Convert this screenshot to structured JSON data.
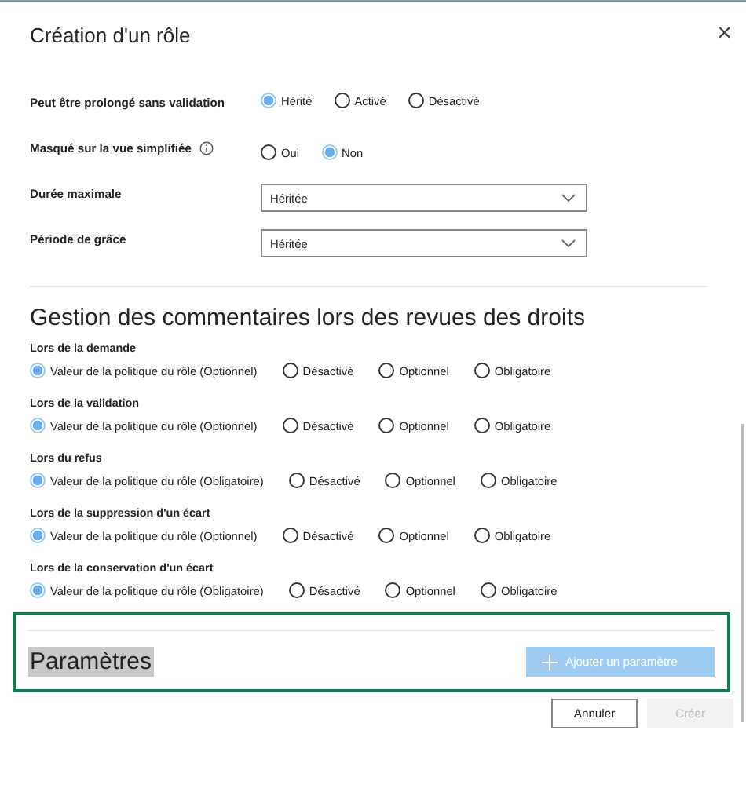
{
  "dialog": {
    "title": "Création d'un rôle",
    "close": "×"
  },
  "settings": [
    {
      "kind": "radio",
      "label": "Peut être prolongé sans validation",
      "info": false,
      "options": [
        {
          "label": "Hérité",
          "selected": true
        },
        {
          "label": "Activé",
          "selected": false
        },
        {
          "label": "Désactivé",
          "selected": false
        }
      ]
    },
    {
      "kind": "radio",
      "label": "Masqué sur la vue simplifiée",
      "info": true,
      "options": [
        {
          "label": "Oui",
          "selected": false
        },
        {
          "label": "Non",
          "selected": true
        }
      ]
    },
    {
      "kind": "dropdown",
      "label": "Durée maximale",
      "value": "Héritée"
    },
    {
      "kind": "dropdown",
      "label": "Période de grâce",
      "value": "Héritée"
    }
  ],
  "comments": {
    "heading": "Gestion des commentaires lors des revues des droits",
    "groups": [
      {
        "label": "Lors de la demande",
        "options": [
          {
            "label": "Valeur de la politique du rôle (Optionnel)",
            "selected": true
          },
          {
            "label": "Désactivé",
            "selected": false
          },
          {
            "label": "Optionnel",
            "selected": false
          },
          {
            "label": "Obligatoire",
            "selected": false
          }
        ]
      },
      {
        "label": "Lors de la validation",
        "options": [
          {
            "label": "Valeur de la politique du rôle (Optionnel)",
            "selected": true
          },
          {
            "label": "Désactivé",
            "selected": false
          },
          {
            "label": "Optionnel",
            "selected": false
          },
          {
            "label": "Obligatoire",
            "selected": false
          }
        ]
      },
      {
        "label": "Lors du refus",
        "options": [
          {
            "label": "Valeur de la politique du rôle (Obligatoire)",
            "selected": true
          },
          {
            "label": "Désactivé",
            "selected": false
          },
          {
            "label": "Optionnel",
            "selected": false
          },
          {
            "label": "Obligatoire",
            "selected": false
          }
        ]
      },
      {
        "label": "Lors de la suppression d'un écart",
        "options": [
          {
            "label": "Valeur de la politique du rôle (Optionnel)",
            "selected": true
          },
          {
            "label": "Désactivé",
            "selected": false
          },
          {
            "label": "Optionnel",
            "selected": false
          },
          {
            "label": "Obligatoire",
            "selected": false
          }
        ]
      },
      {
        "label": "Lors de la conservation d'un écart",
        "options": [
          {
            "label": "Valeur de la politique du rôle (Obligatoire)",
            "selected": true
          },
          {
            "label": "Désactivé",
            "selected": false
          },
          {
            "label": "Optionnel",
            "selected": false
          },
          {
            "label": "Obligatoire",
            "selected": false
          }
        ]
      }
    ]
  },
  "parameters": {
    "heading": "Paramètres",
    "add_button": {
      "label": "Ajouter un paramètre",
      "disabled": true
    }
  },
  "buttons": [
    {
      "label": "Annuler",
      "disabled": false
    },
    {
      "label": "Créer",
      "disabled": true
    }
  ]
}
